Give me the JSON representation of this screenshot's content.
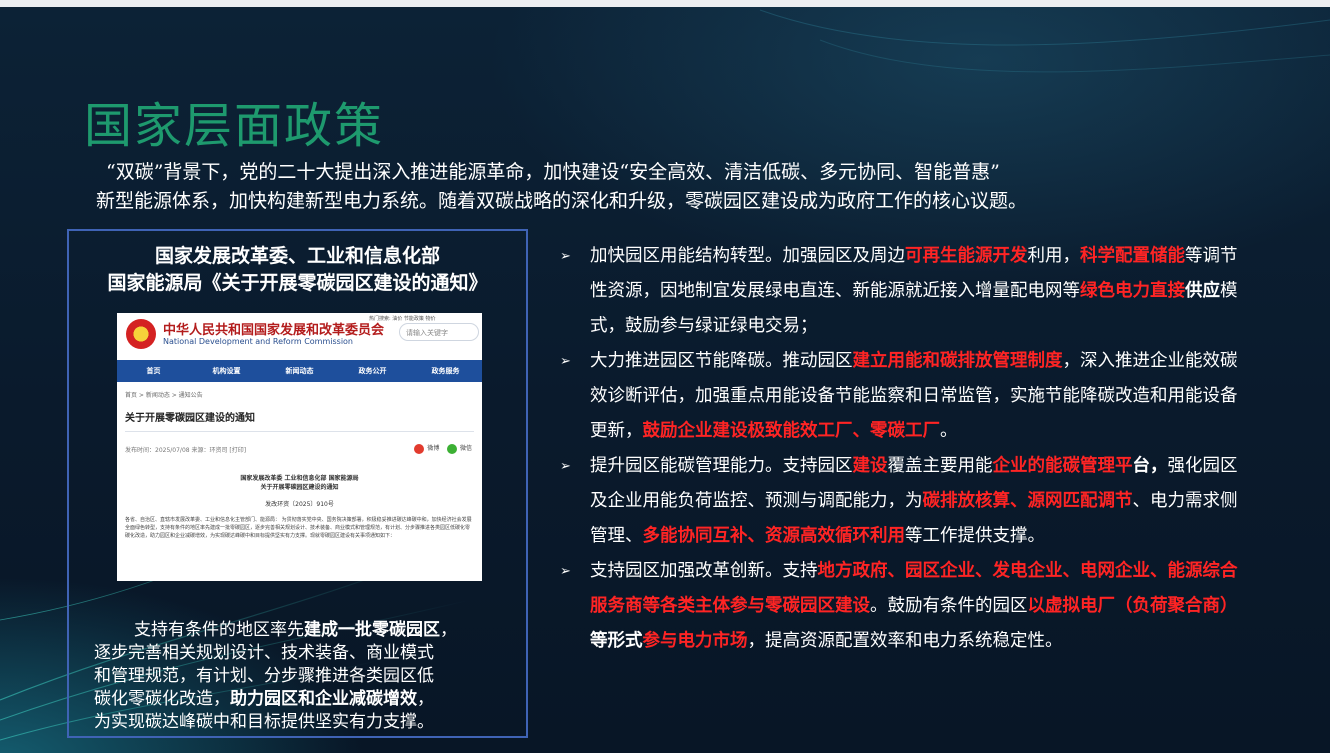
{
  "slide": {
    "title": "国家层面政策",
    "intro": {
      "line1": "“双碳”背景下，党的二十大提出深入推进能源革命，加快建设“安全高效、清洁低碳、多元协同、智能普惠”",
      "line2": "新型能源体系，加快构建新型电力系统。随着双碳战略的深化和升级，零碳园区建设成为政府工作的核心议题。"
    }
  },
  "notice_box": {
    "heading_line1": "国家发展改革委、工业和信息化部",
    "heading_line2": "国家能源局《关于开展零碳园区建设的通知》",
    "screenshot": {
      "org_cn": "中华人民共和国国家发展和改革委员会",
      "org_en": "National Development and Reform Commission",
      "hot_links": "热门搜索: 油价 节能政策 物价",
      "search_placeholder": "请输入关键字",
      "nav": [
        "首页",
        "机构设置",
        "新闻动态",
        "政务公开",
        "政务服务"
      ],
      "breadcrumb": "首页 > 新闻动态 > 通知公告",
      "article_title": "关于开展零碳园区建设的通知",
      "meta": "发布时间：2025/07/08      来源：环资司      [打印]",
      "share": [
        "微博",
        "微信"
      ],
      "doc_heading1": "国家发展改革委 工业和信息化部 国家能源局",
      "doc_heading2": "关于开展零碳园区建设的通知",
      "doc_number": "发改环资〔2025〕910号",
      "doc_body": "各省、自治区、直辖市发展改革委、工业和信息化主管部门、能源局： 为贯彻落实党中央、国务院决策部署，积极稳妥推进碳达峰碳中和，加快经济社会发展全面绿色转型，支持有条件的地区率先建成一批零碳园区，逐步完善相关规划设计、技术装备、商业模式和管理规范，有计划、分步骤推进各类园区低碳化零碳化改造，助力园区和企业减碳增效，为实现碳达峰碳中和目标提供坚实有力支撑。现就零碳园区建设有关事项通知如下："
    },
    "text": {
      "p1a": "支持有条件的地区率先",
      "p1b": "建成一批零碳园区",
      "p1c": "，",
      "p2": "逐步完善相关规划设计、技术装备、商业模式",
      "p3": "和管理规范，有计划、分步骤推进各类园区低",
      "p4a": "碳化零碳化改造，",
      "p4b": "助力园区和企业减碳增效",
      "p4c": "，",
      "p5": "为实现碳达峰碳中和目标提供坚实有力支撑。"
    }
  },
  "points": [
    {
      "segments": [
        {
          "t": "加快园区用能结构转型。加强园区及周边",
          "s": "n"
        },
        {
          "t": "可再生能源开发",
          "s": "r"
        },
        {
          "t": "利用，",
          "s": "n"
        },
        {
          "t": "科学配置储能",
          "s": "r"
        },
        {
          "t": "等调节性资源，因地制宜发展绿电直连、新能源就近接入增量配电网等",
          "s": "n"
        },
        {
          "t": "绿色电力直接",
          "s": "r"
        },
        {
          "t": "供应",
          "s": "w"
        },
        {
          "t": "模式，鼓励参与绿证绿电交易；",
          "s": "n"
        }
      ]
    },
    {
      "segments": [
        {
          "t": "大力推进园区节能降碳。推动园区",
          "s": "n"
        },
        {
          "t": "建立用能和碳排放管理制度",
          "s": "r"
        },
        {
          "t": "，深入推进企业能效碳效诊断评估，加强重点用能设备节能监察和日常监管，实施节能降碳改造和用能设备更新，",
          "s": "n"
        },
        {
          "t": "鼓励企业建设极致能效工厂、零碳工厂",
          "s": "r"
        },
        {
          "t": "。",
          "s": "n"
        }
      ]
    },
    {
      "segments": [
        {
          "t": "提升园区能碳管理能力。支持园区",
          "s": "n"
        },
        {
          "t": "建设",
          "s": "r"
        },
        {
          "t": "覆盖主要用能",
          "s": "n"
        },
        {
          "t": "企业的能碳管理平",
          "s": "r"
        },
        {
          "t": "台，",
          "s": "w"
        },
        {
          "t": "强化园区及企业用能负荷监控、预测与调配能力，为",
          "s": "n"
        },
        {
          "t": "碳排放核算、源网匹配调节",
          "s": "r"
        },
        {
          "t": "、电力需求侧管理、",
          "s": "n"
        },
        {
          "t": "多能协同互补、资源高效循环利用",
          "s": "r"
        },
        {
          "t": "等工作提供支撑。",
          "s": "n"
        }
      ]
    },
    {
      "segments": [
        {
          "t": "支持园区加强改革创新。支持",
          "s": "n"
        },
        {
          "t": "地方政府、园区企业、发电企业、电网企业、能源综合服务商等各类主体参与零碳园区建设",
          "s": "r"
        },
        {
          "t": "。鼓励有条件的园区",
          "s": "n"
        },
        {
          "t": "以虚拟电厂（负荷聚合商）",
          "s": "r"
        },
        {
          "t": "等形式",
          "s": "w"
        },
        {
          "t": "参与电力市场",
          "s": "r"
        },
        {
          "t": "，提高资源配置效率和电力系统稳定性。",
          "s": "n"
        }
      ]
    }
  ],
  "colors": {
    "title_green": "#1e9a6e",
    "highlight_red": "#ff2424",
    "box_border": "#3f63b5",
    "nav_blue": "#1e4f9c"
  }
}
